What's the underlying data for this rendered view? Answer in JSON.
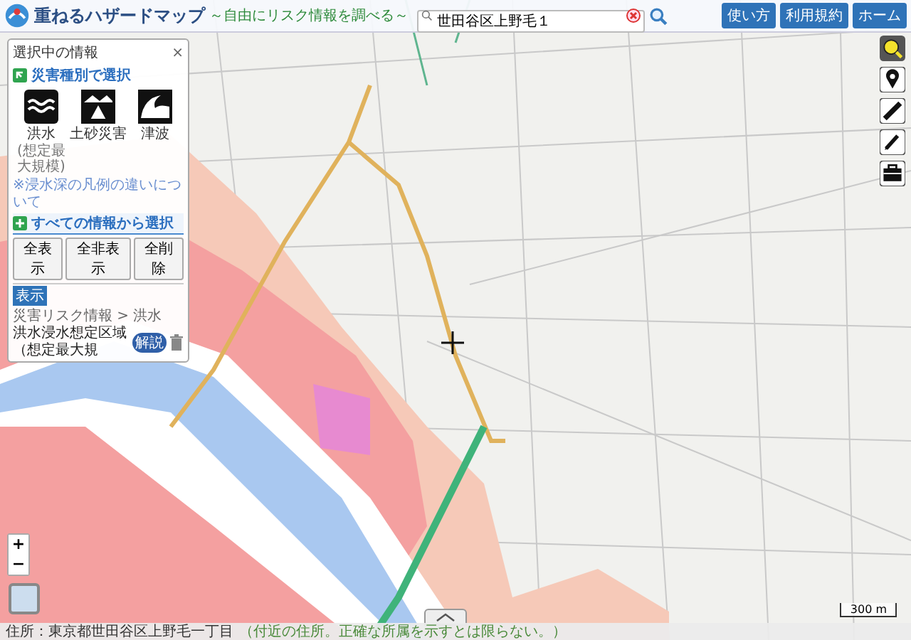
{
  "header": {
    "title": "重ねるハザードマップ",
    "subtitle": "～自由にリスク情報を調べる～",
    "search": {
      "value": "世田谷区上野毛１"
    },
    "buttons": [
      "使い方",
      "利用規約",
      "ホーム"
    ]
  },
  "panel": {
    "title": "選択中の情報",
    "close": "×",
    "disaster_section": {
      "title": "災害種別で選択"
    },
    "hazards": [
      {
        "kind": "flood",
        "label": "洪水",
        "note": "(想定最大規模)"
      },
      {
        "kind": "landslide",
        "label": "土砂災害"
      },
      {
        "kind": "tsunami",
        "label": "津波"
      }
    ],
    "legend_link": "※浸水深の凡例の違いについて",
    "all_section": {
      "title": "すべての情報から選択"
    },
    "actions": [
      "全表示",
      "全非表示",
      "全削除"
    ],
    "layers": [
      {
        "badge": "表示",
        "path": "災害リスク情報 > 洪水",
        "name": "洪水浸水想定区域（想定最大規",
        "info": "解説"
      }
    ]
  },
  "map": {
    "zoom_buttons": [
      "+",
      "−"
    ],
    "scale": "300 m"
  },
  "status_bar": {
    "address": "住所：東京都世田谷区上野毛一丁目",
    "note": "（付近の住所。正確な所属を示すとは限らない。）"
  }
}
